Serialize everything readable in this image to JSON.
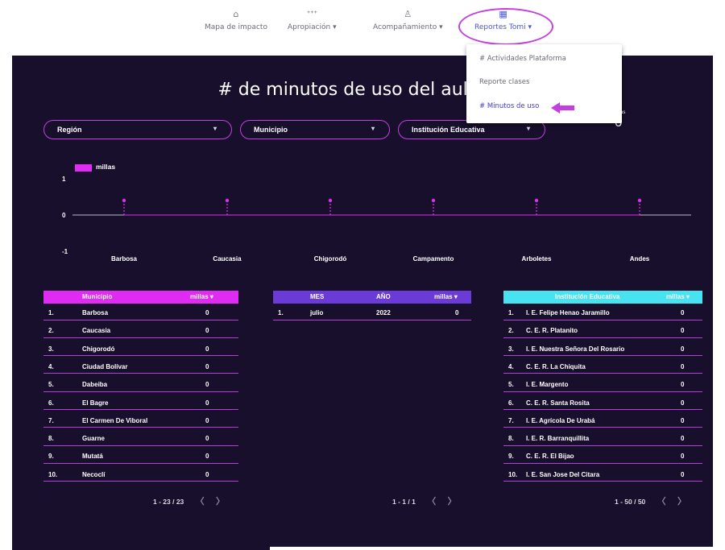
{
  "nav": {
    "items": [
      {
        "label": "Mapa de impacto",
        "icon": "home-icon",
        "glyph": "⌂",
        "has_caret": false
      },
      {
        "label": "Apropiación",
        "icon": "people-icon",
        "glyph": "ᐩᐩᐩ",
        "has_caret": true
      },
      {
        "label": "Acompañamiento",
        "icon": "group-icon",
        "glyph": "♙",
        "has_caret": true
      },
      {
        "label": "Reportes Tomi",
        "icon": "report-icon",
        "glyph": "▦",
        "has_caret": true
      }
    ],
    "caret": "▾",
    "highlight_color": "#c43fe0",
    "active_color": "#4a56d8"
  },
  "menu": {
    "items": [
      {
        "label": "# Actividades Plataforma",
        "selected": false
      },
      {
        "label": "Reporte clases",
        "selected": false
      },
      {
        "label": "# Minutos de uso",
        "selected": true
      }
    ],
    "arrow_color": "#c43fe0"
  },
  "dashboard": {
    "title": "# de minutos de uso del aula - T",
    "background": "#170f2c",
    "scorecard": {
      "label": "millas",
      "value": "0"
    }
  },
  "filters": [
    {
      "label": "Región",
      "caret": "▾"
    },
    {
      "label": "Municipio",
      "caret": "▾"
    },
    {
      "label": "Institución Educativa",
      "caret": "▾"
    }
  ],
  "chart_data": {
    "type": "line",
    "categories": [
      "Barbosa",
      "Caucasia",
      "Chigorodó",
      "Campamento",
      "Arboletes",
      "Andes"
    ],
    "series": [
      {
        "name": "millas",
        "values": [
          0,
          0,
          0,
          0,
          0,
          0
        ],
        "color": "#e02cf2"
      }
    ],
    "ylim": [
      -1,
      1
    ],
    "yticks": [
      "1",
      "0",
      "-1"
    ],
    "legend": "top-left",
    "grid": false
  },
  "tables": {
    "municipio": {
      "header_color": "#e02cf2",
      "columns": [
        "Municipio",
        "millas ▾"
      ],
      "rows": [
        [
          "1.",
          "Barbosa",
          "0"
        ],
        [
          "2.",
          "Caucasia",
          "0"
        ],
        [
          "3.",
          "Chigorodó",
          "0"
        ],
        [
          "4.",
          "Ciudad Bolívar",
          "0"
        ],
        [
          "5.",
          "Dabeiba",
          "0"
        ],
        [
          "6.",
          "El Bagre",
          "0"
        ],
        [
          "7.",
          "El Carmen De Viboral",
          "0"
        ],
        [
          "8.",
          "Guarne",
          "0"
        ],
        [
          "9.",
          "Mutatá",
          "0"
        ],
        [
          "10.",
          "Necoclí",
          "0"
        ]
      ],
      "pager": "1 - 23 / 23"
    },
    "mes": {
      "header_color": "#6b3bd8",
      "columns": [
        "MES",
        "AÑO",
        "millas ▾"
      ],
      "rows": [
        [
          "1.",
          "julio",
          "2022",
          "0"
        ]
      ],
      "pager": "1 - 1 / 1"
    },
    "institucion": {
      "header_color": "#47e3f0",
      "columns": [
        "Institución Educativa",
        "millas ▾"
      ],
      "rows": [
        [
          "1.",
          "I. E. Felipe Henao Jaramillo",
          "0"
        ],
        [
          "2.",
          "C. E. R. Platanito",
          "0"
        ],
        [
          "3.",
          "I. E. Nuestra Señora Del Rosario",
          "0"
        ],
        [
          "4.",
          "C. E. R. La Chiquita",
          "0"
        ],
        [
          "5.",
          "I. E. Margento",
          "0"
        ],
        [
          "6.",
          "C. E. R. Santa Rosita",
          "0"
        ],
        [
          "7.",
          "I. E. Agrícola De Urabá",
          "0"
        ],
        [
          "8.",
          "I. E. R. Barranquillita",
          "0"
        ],
        [
          "9.",
          "C. E. R. El Bijao",
          "0"
        ],
        [
          "10.",
          "I. E. San Jose Del Citara",
          "0"
        ]
      ],
      "pager": "1 - 50 / 50"
    },
    "pager_prev": "〈",
    "pager_next": "〉"
  }
}
